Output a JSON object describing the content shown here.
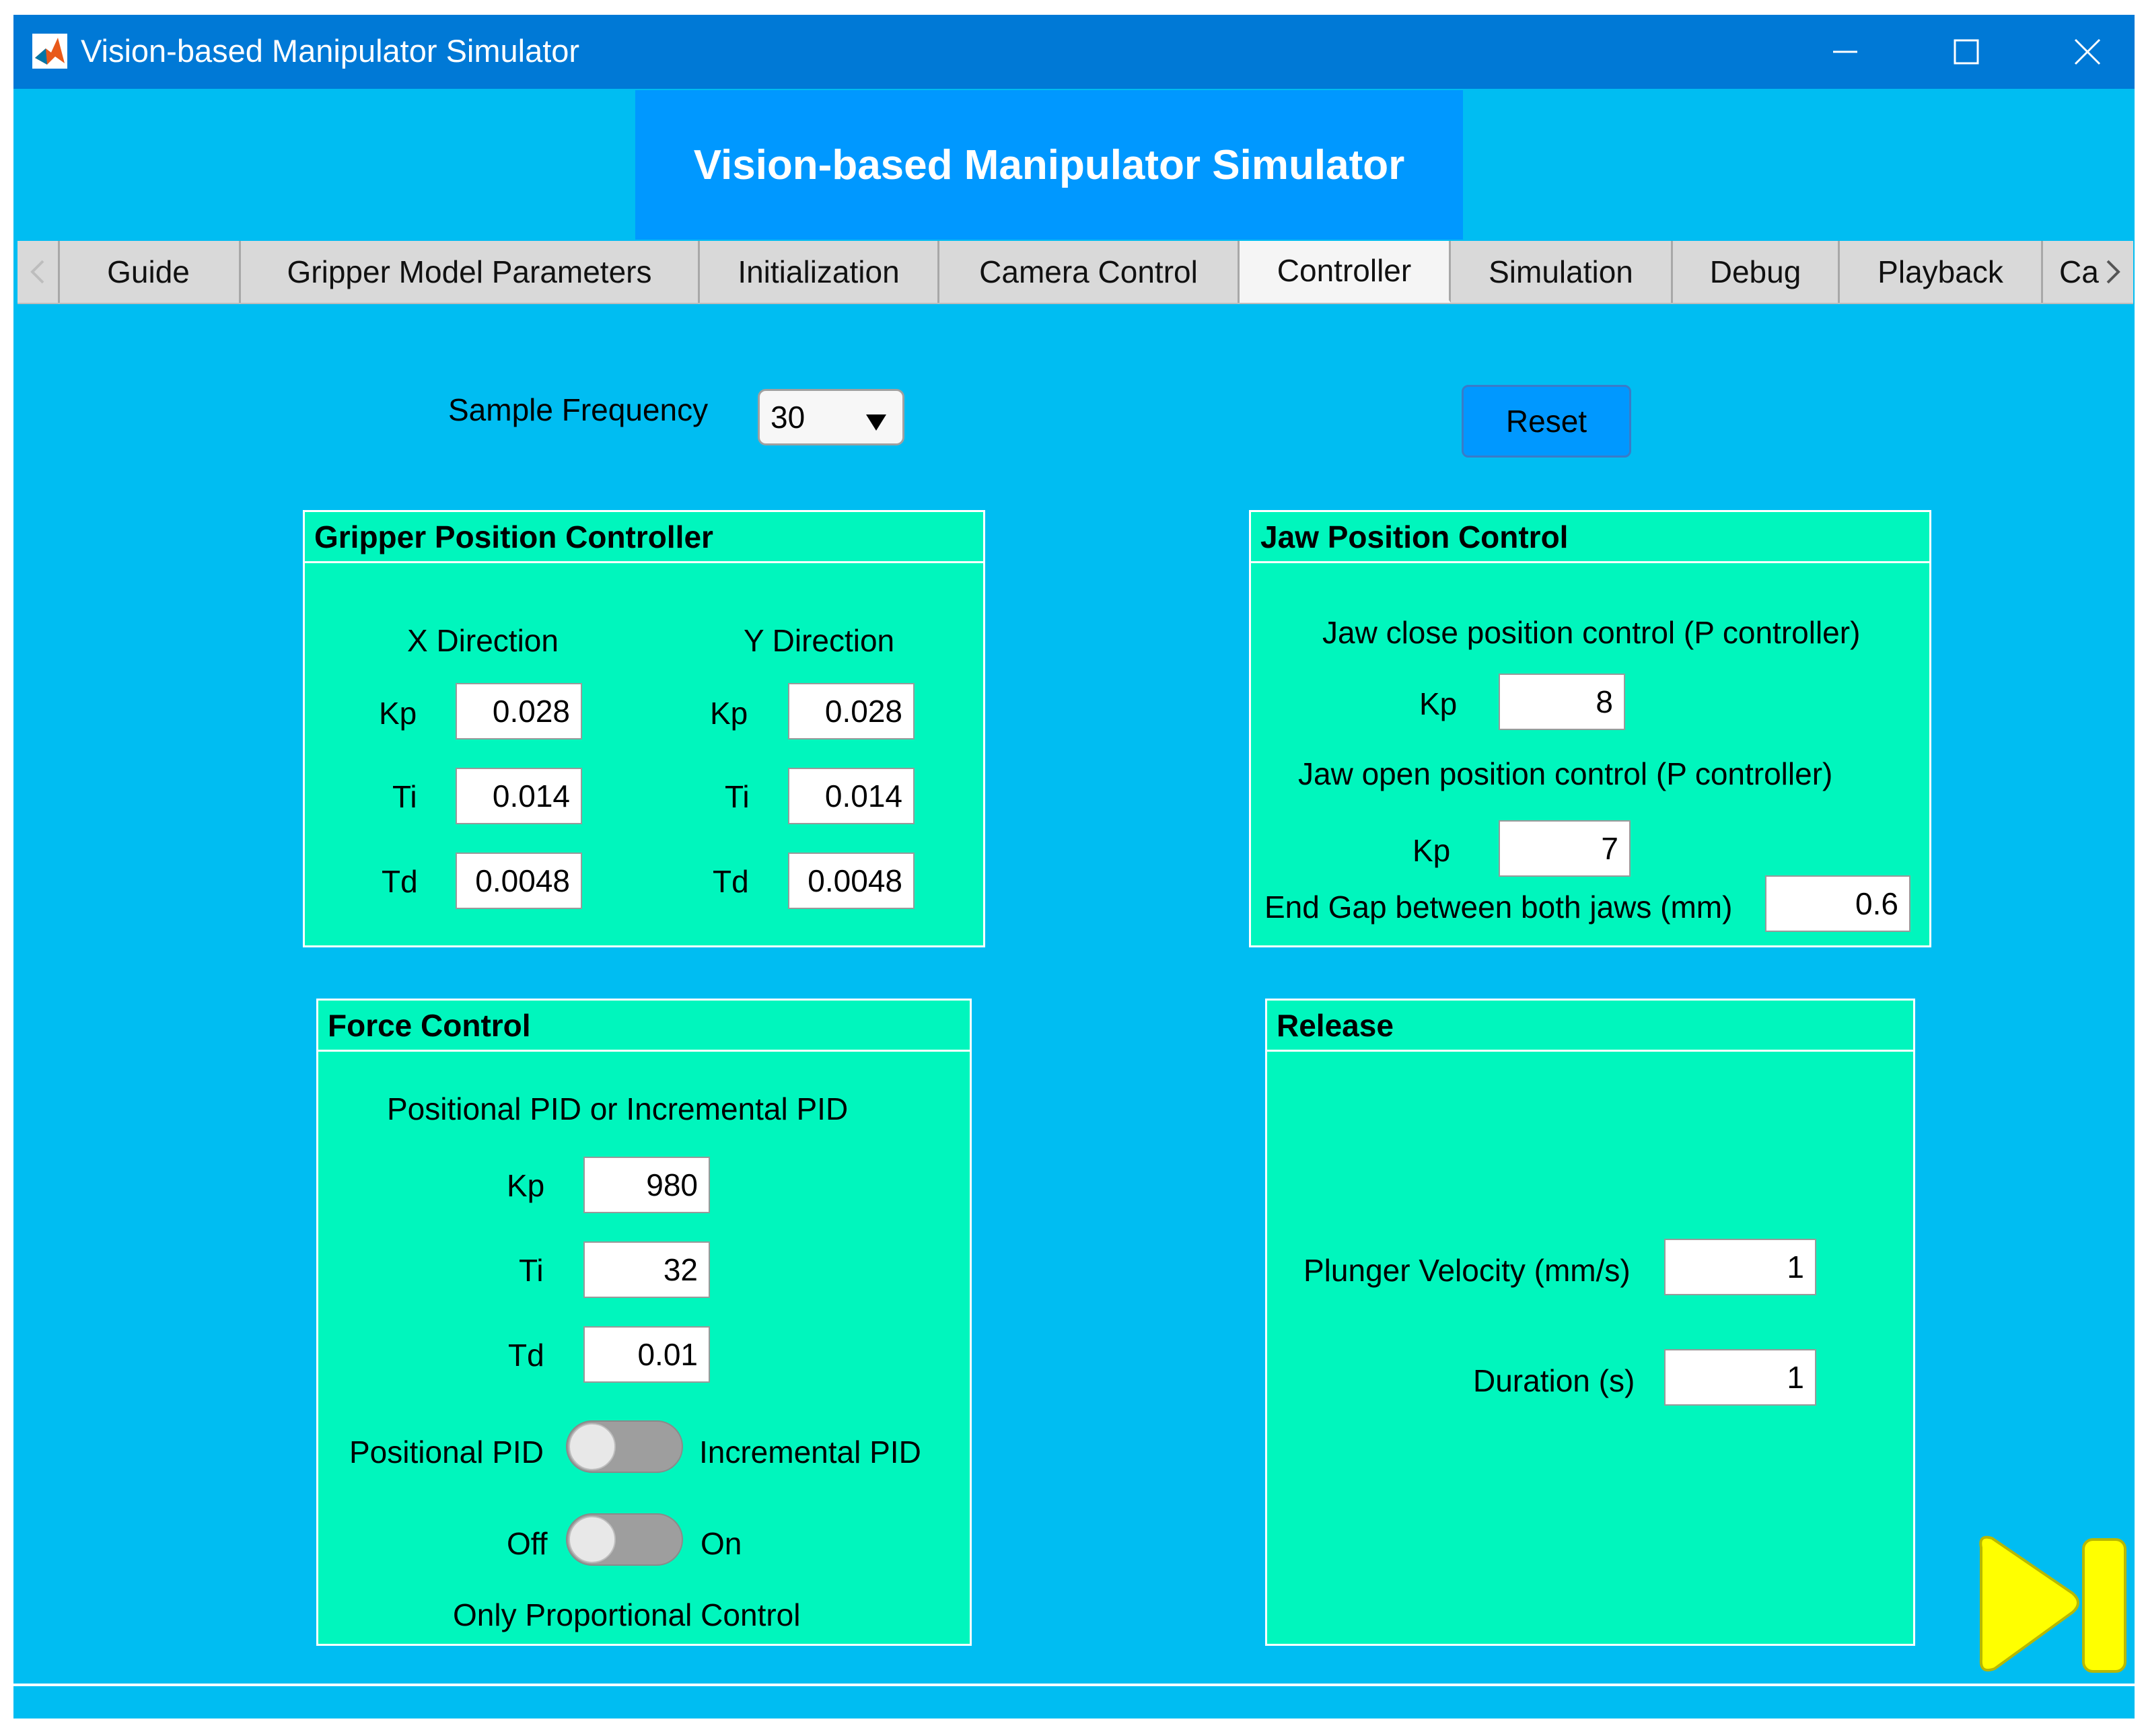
{
  "window": {
    "title": "Vision-based Manipulator Simulator",
    "controls": [
      "minimize-icon",
      "maximize-icon",
      "close-icon"
    ]
  },
  "header": {
    "title": "Vision-based Manipulator Simulator"
  },
  "tabs": [
    "Guide",
    "Gripper Model Parameters",
    "Initialization",
    "Camera Control",
    "Controller",
    "Simulation",
    "Debug",
    "Playback",
    "Ca"
  ],
  "active_tab": "Controller",
  "top": {
    "sample_frequency_label": "Sample Frequency",
    "sample_frequency_value": "30",
    "reset_label": "Reset"
  },
  "gripper_position": {
    "title": "Gripper Position Controller",
    "x_heading": "X Direction",
    "y_heading": "Y Direction",
    "kp_label": "Kp",
    "ti_label": "Ti",
    "td_label": "Td",
    "x": {
      "kp": "0.028",
      "ti": "0.014",
      "td": "0.0048"
    },
    "y": {
      "kp": "0.028",
      "ti": "0.014",
      "td": "0.0048"
    }
  },
  "jaw_position": {
    "title": "Jaw Position Control",
    "close_heading": "Jaw close position control (P controller)",
    "close_kp_label": "Kp",
    "close_kp": "8",
    "open_heading": "Jaw open position control (P controller)",
    "open_kp_label": "Kp",
    "open_kp": "7",
    "end_gap_label": "End Gap between both jaws (mm)",
    "end_gap": "0.6"
  },
  "force_control": {
    "title": "Force Control",
    "heading": "Positional PID or Incremental PID",
    "kp_label": "Kp",
    "kp": "980",
    "ti_label": "Ti",
    "ti": "32",
    "td_label": "Td",
    "td": "0.01",
    "mode_left": "Positional PID",
    "mode_right": "Incremental PID",
    "p_left": "Off",
    "p_right": "On",
    "p_caption": "Only Proportional Control"
  },
  "release": {
    "title": "Release",
    "velocity_label": "Plunger Velocity (mm/s)",
    "velocity": "1",
    "duration_label": "Duration (s)",
    "duration": "1"
  },
  "colors": {
    "titlebar": "#0079d6",
    "background": "#00bdf2",
    "header": "#0098ff",
    "panel": "#00f6bd",
    "next_button": "#ffff00"
  },
  "icons": {
    "app": "matlab-icon",
    "next": "skip-forward-icon"
  }
}
